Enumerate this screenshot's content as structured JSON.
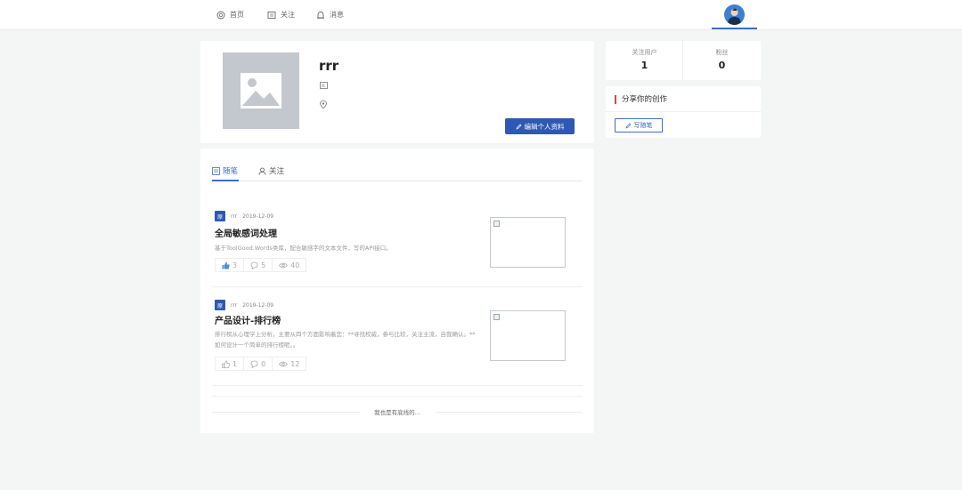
{
  "nav": {
    "items": [
      {
        "label": "首页",
        "icon": "globe-icon"
      },
      {
        "label": "关注",
        "icon": "news-icon"
      },
      {
        "label": "消息",
        "icon": "bell-icon"
      }
    ]
  },
  "profile": {
    "username": "rrr",
    "edit_label": "编辑个人资料"
  },
  "stats": {
    "following_label": "关注用户",
    "following_count": "1",
    "followers_label": "粉丝",
    "followers_count": "0"
  },
  "share": {
    "title": "分享你的创作",
    "write_label": "写随笔"
  },
  "tabs": [
    {
      "label": "随笔",
      "active": true
    },
    {
      "label": "关注",
      "active": false
    }
  ],
  "posts": [
    {
      "badge": "原",
      "author": "rrr",
      "date": "2019-12-09",
      "title": "全局敏感词处理",
      "summary": "基于ToolGood.Words类库，配合敏感字的文本文件，写的API接口。",
      "likes": "3",
      "liked": true,
      "comments": "5",
      "views": "40"
    },
    {
      "badge": "原",
      "author": "rrr",
      "date": "2019-12-09",
      "title": "产品设计-排行榜",
      "summary": "排行榜从心理学上分析，主要从四个方面影响着您：**寻找权威，参与比较，关注主流，自我确认。** 如何设计一个简单的排行榜呢。。",
      "likes": "1",
      "liked": false,
      "comments": "0",
      "views": "12"
    }
  ],
  "end_text": "我也是有底线的...",
  "colors": {
    "primary": "#2f58b4",
    "accent_red": "#e0453c",
    "background": "#f4f5f5"
  }
}
